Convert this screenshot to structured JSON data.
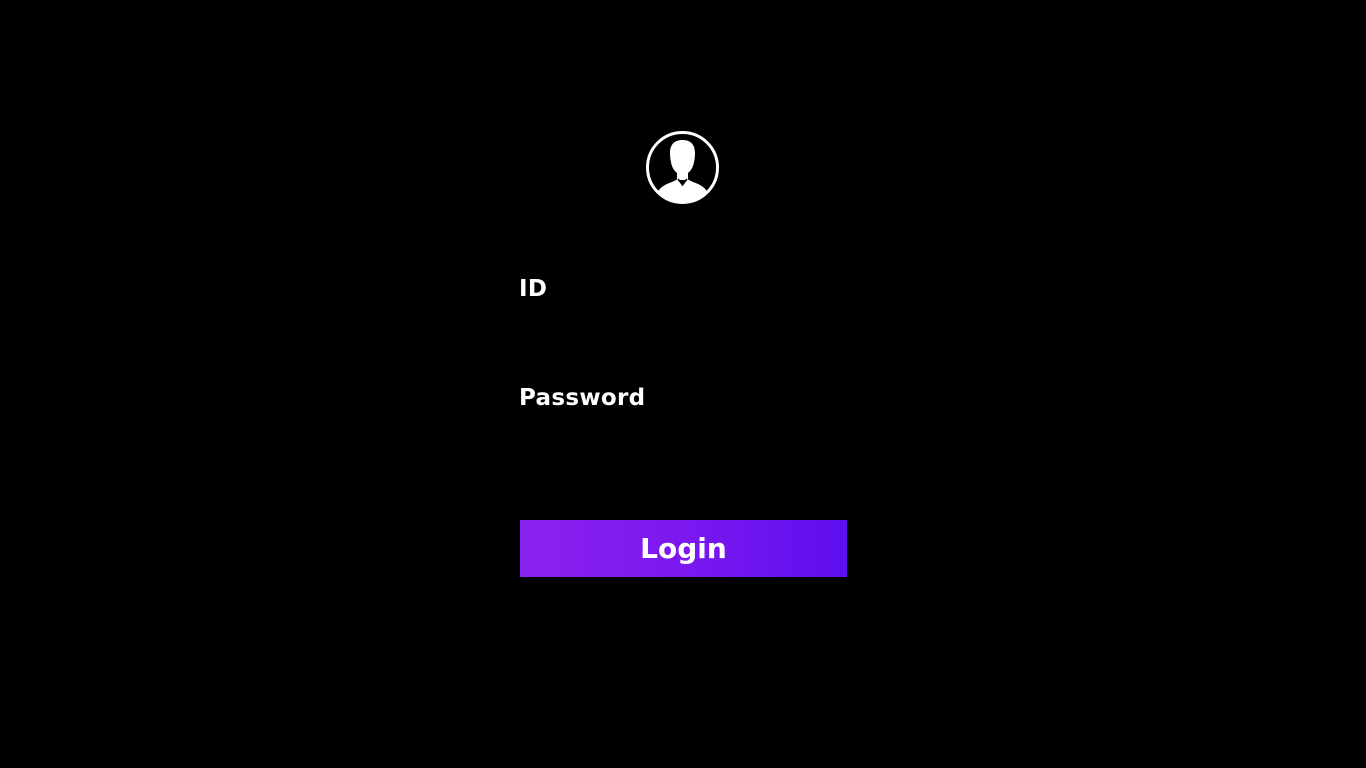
{
  "avatar": {
    "icon": "user-silhouette-icon"
  },
  "form": {
    "id_label": "ID",
    "id_value": "",
    "password_label": "Password",
    "password_value": "",
    "login_label": "Login"
  },
  "colors": {
    "background": "#000000",
    "text": "#ffffff",
    "button_gradient_start": "#8b22ee",
    "button_gradient_end": "#5e0ef0"
  }
}
